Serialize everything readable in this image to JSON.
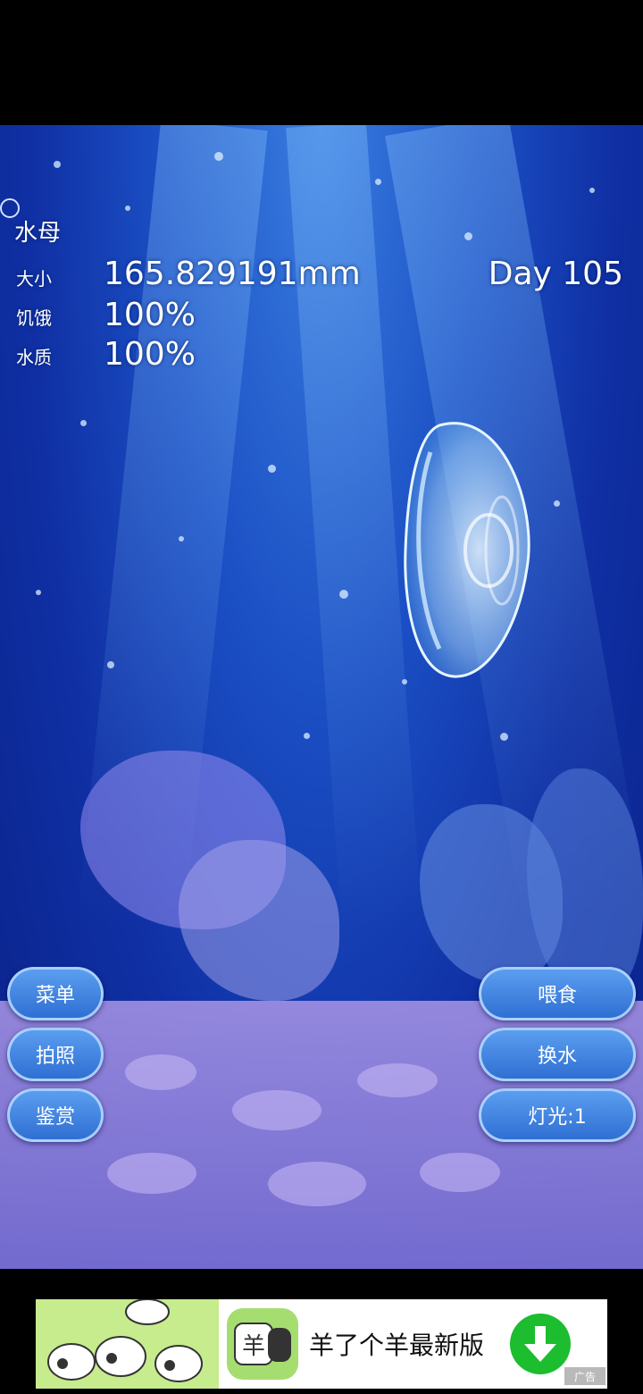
{
  "hud": {
    "title": "水母",
    "size_label": "大小",
    "size_value": "165.829191mm",
    "day": "Day 105",
    "hunger_label": "饥饿",
    "hunger_value": "100%",
    "water_label": "水质",
    "water_value": "100%"
  },
  "buttons_left": {
    "menu": "菜单",
    "photo": "拍照",
    "appreciate": "鉴赏"
  },
  "buttons_right": {
    "feed": "喂食",
    "change_water": "换水",
    "light": "灯光:1"
  },
  "ad": {
    "text": "羊了个羊最新版",
    "tag": "广告",
    "icon_char": "羊"
  },
  "colors": {
    "water": "#1b4fc4",
    "button": "#3f84e0",
    "download": "#1cbd2f"
  }
}
